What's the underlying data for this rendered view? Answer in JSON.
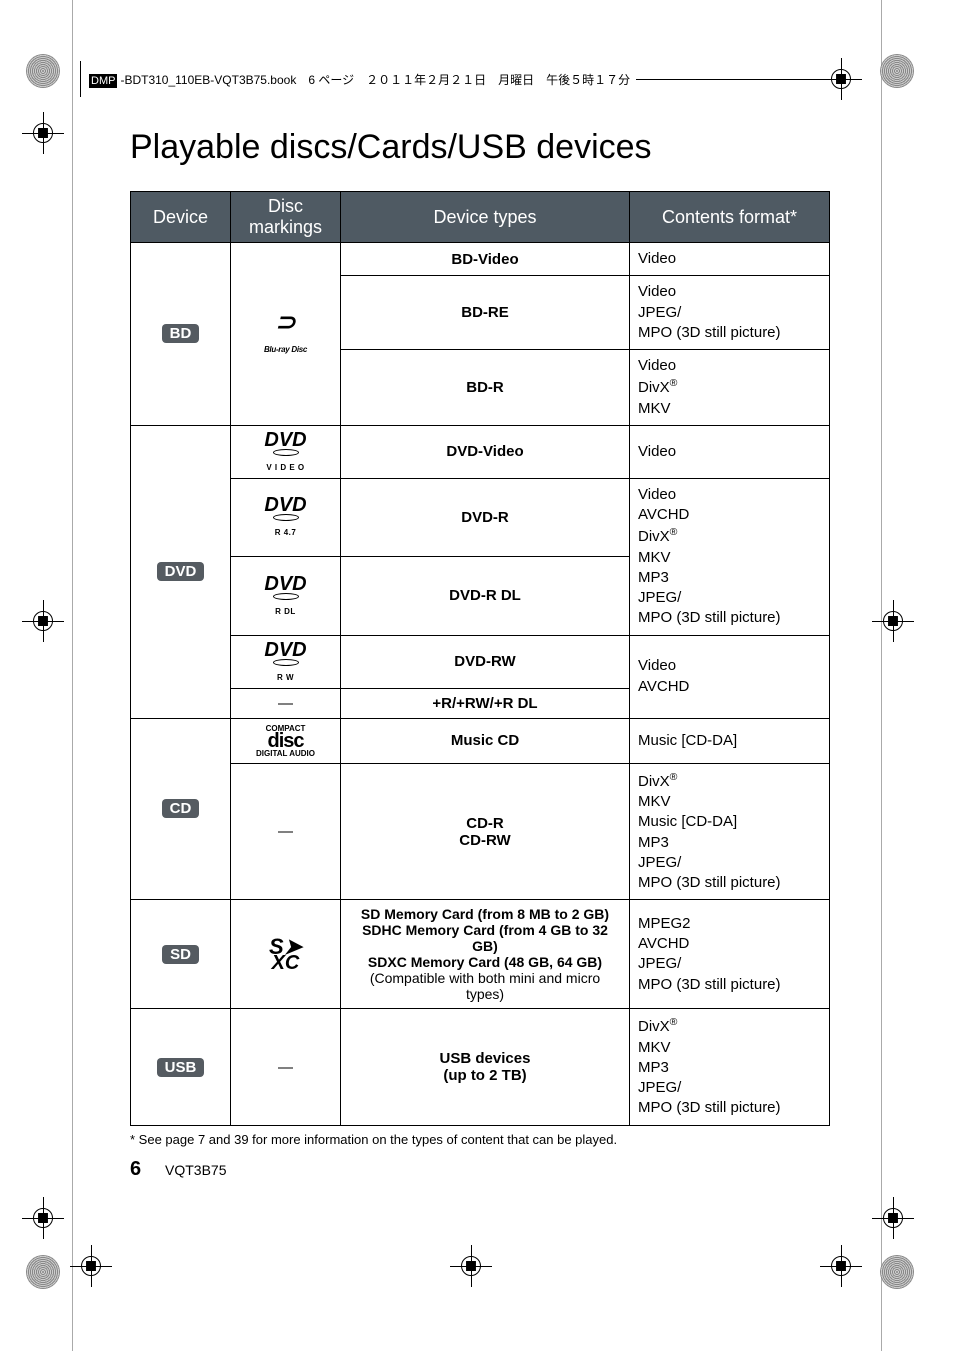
{
  "file_header": {
    "invert": "DMP",
    "rest": "-BDT310_110EB-VQT3B75.book　6 ページ　２０１１年２月２１日　月曜日　午後５時１７分"
  },
  "title": "Playable discs/Cards/USB devices",
  "headers": {
    "device": "Device",
    "markings": "Disc markings",
    "types": "Device types",
    "format": "Contents format*"
  },
  "labels": {
    "bd": "BD",
    "dvd": "DVD",
    "cd": "CD",
    "sd": "SD",
    "usb": "USB"
  },
  "logo": {
    "bd": "Blu-ray Disc",
    "dvd_video": "V I D E O",
    "dvd_r": "R 4.7",
    "dvd_rdl": "R DL",
    "dvd_rw": "R W",
    "cd_top": "COMPACT",
    "cd_bot": "DIGITAL AUDIO",
    "sd": "S",
    "sd_xc": "XC"
  },
  "types": {
    "bd_video": "BD-Video",
    "bd_re": "BD-RE",
    "bd_r": "BD-R",
    "dvd_video": "DVD-Video",
    "dvd_r": "DVD-R",
    "dvd_r_dl": "DVD-R DL",
    "dvd_rw": "DVD-RW",
    "plusr": "+R/+RW/+R DL",
    "music_cd": "Music CD",
    "cd_r": "CD-R",
    "cd_rw": "CD-RW",
    "sd1": "SD Memory Card (from 8 MB to 2 GB)",
    "sd2": "SDHC Memory Card (from 4 GB to 32 GB)",
    "sd3": "SDXC Memory Card (48 GB, 64 GB)",
    "sd4": "(Compatible with both mini and micro types)",
    "usb1": "USB devices",
    "usb2": "(up to 2 TB)"
  },
  "fmt": {
    "video": "Video",
    "jpeg": "JPEG/",
    "mpo": "MPO (3D still picture)",
    "divx": "DivX",
    "mkv": "MKV",
    "avchd": "AVCHD",
    "mp3": "MP3",
    "music_cdda": "Music [CD-DA]",
    "mpeg2": "MPEG2"
  },
  "reg": "®",
  "dash": "—",
  "footnote": "* See page 7 and 39 for more information on the types of content that can be played.",
  "page_num": "6",
  "doc_code": "VQT3B75"
}
